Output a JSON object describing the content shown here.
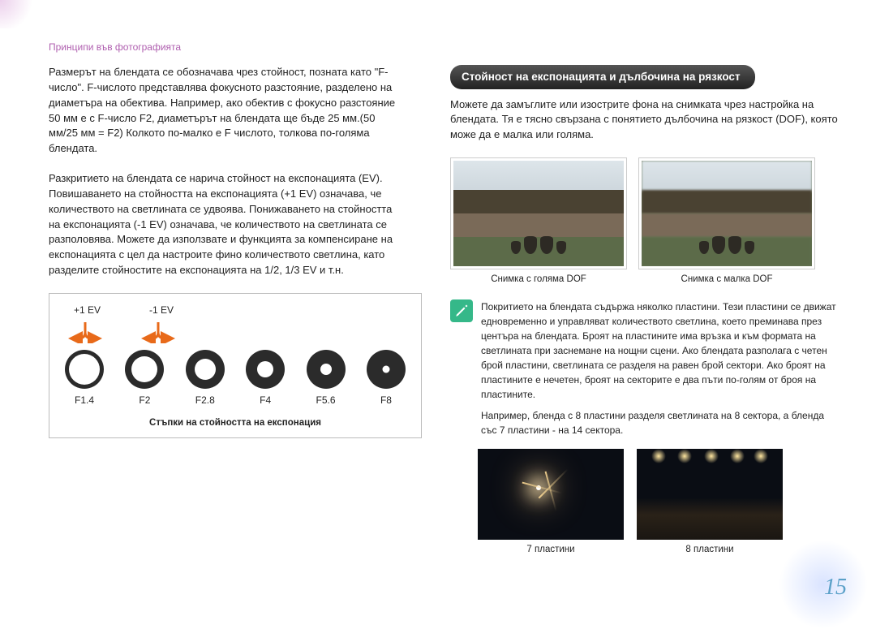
{
  "header_title": "Принципи във фотографията",
  "left": {
    "para1": "Размерът на блендата се обозначава чрез стойност, позната като \"F-число\". F-числото представлява фокусното разстояние, разделено на диаметъра на обектива. Например, ако обектив с фокусно разстояние 50 мм е с F-число F2, диаметърът на блендата ще бъде 25 мм.(50 мм/25 мм = F2) Колкото по-малко е F числото, толкова по-голяма блендата.",
    "para2": "Разкритието на блендата се нарича стойност на експонацията (EV). Повишаването на стойността на експонацията (+1 EV) означава, че количеството на светлината се удвоява. Понижаването на стойността на експонацията (-1 EV) означава, че количеството на светлината се разполовява. Можете да използвате и функцията за компенсиране на експонацията с цел да настроите фино количеството светлина, като разделите стойностите на експонацията на 1/2, 1/3 EV и т.н.",
    "ev_plus": "+1 EV",
    "ev_minus": "-1 EV",
    "apertures": [
      "F1.4",
      "F2",
      "F2.8",
      "F4",
      "F5.6",
      "F8"
    ],
    "diagram_caption": "Стъпки на стойността на експонация"
  },
  "right": {
    "section_title": "Стойност на експонацията и дълбочина на рязкост",
    "para1": "Можете да замъглите или изострите фона на снимката чрез настройка на блендата. Тя е тясно свързана с понятието дълбочина на рязкост (DOF), която може да е малка или голяма.",
    "img_caption1": "Снимка с голяма DOF",
    "img_caption2": "Снимка с малка DOF",
    "info_para1": "Покритието на блендата съдържа няколко пластини. Тези пластини се движат едновременно и управляват количеството светлина, което преминава през центъра на блендата. Броят на пластините има връзка и към формата на светлината при заснемане на нощни сцени. Ако блендата разполага с четен брой пластини, светлината се разделя на равен брой сектори. Ако броят на пластините е нечетен, броят на секторите е два пъти по-голям от броя на пластините.",
    "info_para2": "Например, бленда с 8 пластини разделя светлината на 8 сектора, а бленда със 7 пластини - на 14 сектора.",
    "night_caption1": "7 пластини",
    "night_caption2": "8 пластини"
  },
  "page_number": "15"
}
